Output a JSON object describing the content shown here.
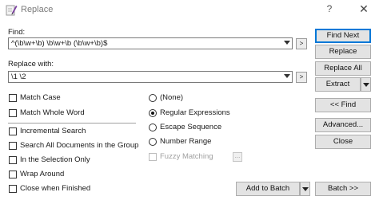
{
  "window": {
    "title": "Replace",
    "help_glyph": "?",
    "close_glyph": "✕",
    "app_icon": "notepad-pen-icon"
  },
  "find": {
    "label": "Find:",
    "value": "^(\\b\\w+\\b) \\b\\w+\\b (\\b\\w+\\b)$",
    "history_arrow_glyph": ">"
  },
  "replace": {
    "label": "Replace with:",
    "value": "\\1 \\2",
    "history_arrow_glyph": ">"
  },
  "checkboxes": {
    "match_case": {
      "label": "Match Case",
      "checked": false
    },
    "match_whole_word": {
      "label": "Match Whole Word",
      "checked": false
    },
    "incremental_search": {
      "label": "Incremental Search",
      "checked": false
    },
    "search_all_documents": {
      "label": "Search All Documents in the Group",
      "checked": false
    },
    "in_selection_only": {
      "label": "In the Selection Only",
      "checked": false
    },
    "wrap_around": {
      "label": "Wrap Around",
      "checked": false
    },
    "close_when_finished": {
      "label": "Close when Finished",
      "checked": false
    },
    "fuzzy_matching": {
      "label": "Fuzzy Matching",
      "checked": false,
      "disabled": true
    }
  },
  "fuzzy_settings_glyph": "...",
  "modes": {
    "none": {
      "label": "(None)",
      "selected": false
    },
    "regex": {
      "label": "Regular Expressions",
      "selected": true
    },
    "escape": {
      "label": "Escape Sequence",
      "selected": false
    },
    "number_range": {
      "label": "Number Range",
      "selected": false
    }
  },
  "buttons": {
    "find_next": "Find Next",
    "replace": "Replace",
    "replace_all": "Replace All",
    "extract": "Extract",
    "find_back": "<< Find",
    "advanced": "Advanced...",
    "close": "Close",
    "add_to_batch": "Add to Batch",
    "batch": "Batch >>"
  }
}
